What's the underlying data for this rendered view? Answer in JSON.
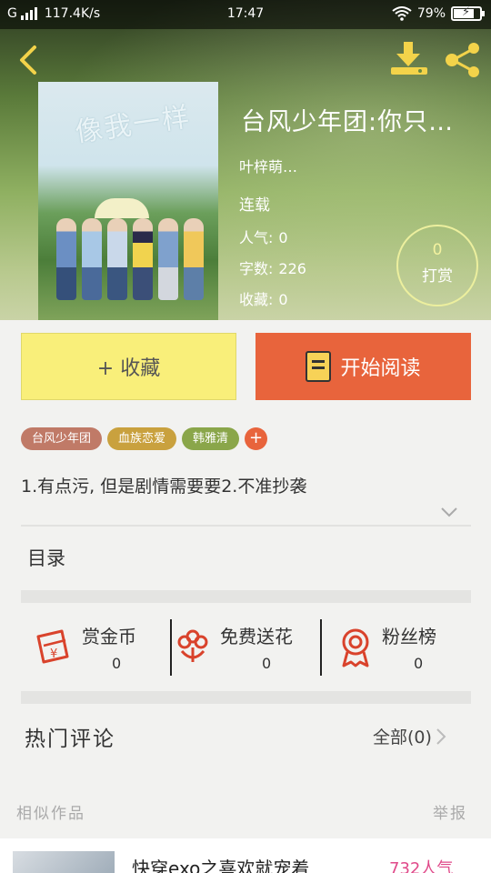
{
  "status_bar": {
    "carrier": "G",
    "network_speed": "117.4K/s",
    "time": "17:47",
    "battery": "79%"
  },
  "book": {
    "cover_art_text": "像我一样",
    "title": "台风少年团:你只…",
    "author": "叶梓萌…",
    "status": "连载",
    "popularity_label": "人气:",
    "popularity_value": "0",
    "word_count_label": "字数:",
    "word_count_value": "226",
    "favorites_label": "收藏:",
    "favorites_value": "0",
    "reward_count": "0",
    "reward_label": "打赏"
  },
  "actions": {
    "collect_label": "+ 收藏",
    "read_label": "开始阅读"
  },
  "tags": [
    {
      "label": "台风少年团",
      "color": "#c07a67"
    },
    {
      "label": "血族恋爱",
      "color": "#c9a13e"
    },
    {
      "label": "韩雅清",
      "color": "#8aa64a"
    }
  ],
  "tag_add": "+",
  "description": "1.有点污, 但是剧情需要要2.不准抄袭",
  "toc_label": "目录",
  "features": [
    {
      "label": "赏金币",
      "count": "0",
      "icon": "red-envelope-icon"
    },
    {
      "label": "免费送花",
      "count": "0",
      "icon": "flower-icon"
    },
    {
      "label": "粉丝榜",
      "count": "0",
      "icon": "medal-icon"
    }
  ],
  "comments": {
    "title": "热门评论",
    "all_label": "全部(0)"
  },
  "similar": {
    "title": "相似作品",
    "report": "举报",
    "item_title": "快穿exo之喜欢就宠着",
    "item_popularity": "732人气"
  },
  "colors": {
    "accent": "#e8643c",
    "collect_bg": "#f9ef7a",
    "icon_red": "#d9432c"
  }
}
